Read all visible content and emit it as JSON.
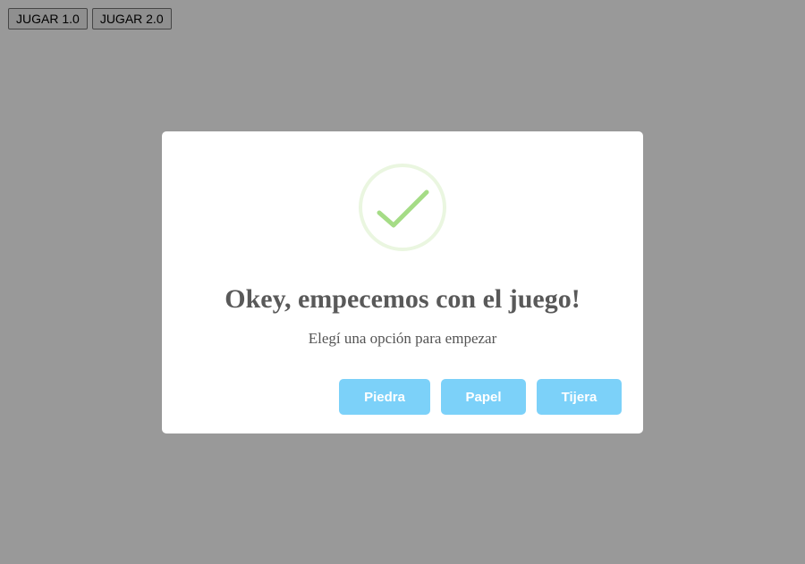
{
  "topbar": {
    "buttons": [
      {
        "label": "JUGAR 1.0"
      },
      {
        "label": "JUGAR 2.0"
      }
    ]
  },
  "modal": {
    "icon": "success-check-icon",
    "title": "Okey, empecemos con el juego!",
    "text": "Elegí una opción para empezar",
    "buttons": [
      {
        "label": "Piedra"
      },
      {
        "label": "Papel"
      },
      {
        "label": "Tijera"
      }
    ]
  },
  "colors": {
    "overlay": "rgba(0,0,0,0.4)",
    "confirm_button": "#7cd1f9",
    "success_ring": "#eaf6e0",
    "success_check": "#a5dc86",
    "title": "#595959",
    "text": "#545454"
  }
}
